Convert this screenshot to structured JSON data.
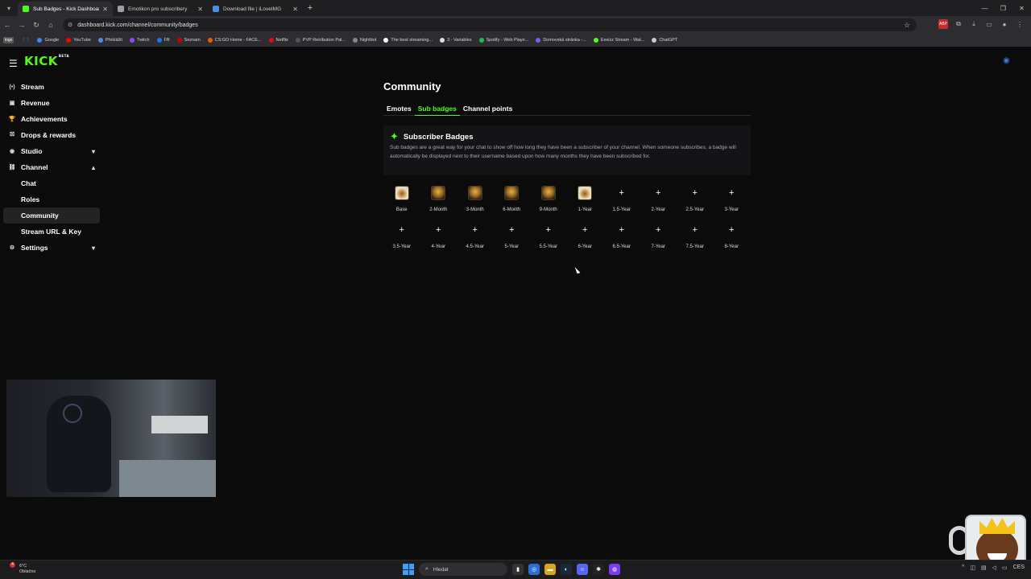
{
  "browser": {
    "tabs": [
      {
        "title": "Sub Badges - Kick Dashboard",
        "active": true,
        "color": "#53fc18"
      },
      {
        "title": "Emotikon pro subscribery",
        "active": false,
        "color": "#9aa0a6"
      },
      {
        "title": "Download file | iLoveIMG",
        "active": false,
        "color": "#4a90e2"
      }
    ],
    "url": "dashboard.kick.com/channel/community/badges",
    "bookmarks": [
      {
        "label": "logo",
        "color": "#555555"
      },
      {
        "label": "Google",
        "color": "#4285f4"
      },
      {
        "label": "YouTube",
        "color": "#ff0000"
      },
      {
        "label": "Překlážit",
        "color": "#4a90e2"
      },
      {
        "label": "Twitch",
        "color": "#9146ff"
      },
      {
        "label": "FB",
        "color": "#1877f2"
      },
      {
        "label": "Seznam",
        "color": "#cc0000"
      },
      {
        "label": "CS:GO Home - FACE...",
        "color": "#ff5500"
      },
      {
        "label": "Netflix",
        "color": "#e50914"
      },
      {
        "label": "PVP Retribution Pal...",
        "color": "#555555"
      },
      {
        "label": "Nightbot",
        "color": "#888888"
      },
      {
        "label": "The best streaming...",
        "color": "#ffffff"
      },
      {
        "label": "3 - Variables",
        "color": "#dddddd"
      },
      {
        "label": "Spotify - Web Playe...",
        "color": "#1db954"
      },
      {
        "label": "Domovská stránka -...",
        "color": "#7a5af8"
      },
      {
        "label": "Exeizz Stream - Wat...",
        "color": "#53fc18"
      },
      {
        "label": "ChatGPT",
        "color": "#cccccc"
      }
    ]
  },
  "app": {
    "logo": "KICK",
    "logo_tag": "BETA",
    "sidebar": [
      {
        "label": "Stream",
        "icon": "broadcast-icon",
        "glyph": "(•)",
        "sub": false,
        "chevron": ""
      },
      {
        "label": "Revenue",
        "icon": "wallet-icon",
        "glyph": "▣",
        "sub": false,
        "chevron": ""
      },
      {
        "label": "Achievements",
        "icon": "trophy-icon",
        "glyph": "🏆",
        "sub": false,
        "chevron": ""
      },
      {
        "label": "Drops & rewards",
        "icon": "gift-icon",
        "glyph": "⛝",
        "sub": false,
        "chevron": ""
      },
      {
        "label": "Studio",
        "icon": "camera-icon",
        "glyph": "◉",
        "sub": false,
        "chevron": "▾"
      },
      {
        "label": "Channel",
        "icon": "channel-icon",
        "glyph": "⛓",
        "sub": false,
        "chevron": "▴"
      },
      {
        "label": "Chat",
        "icon": "",
        "glyph": "",
        "sub": true,
        "chevron": ""
      },
      {
        "label": "Roles",
        "icon": "",
        "glyph": "",
        "sub": true,
        "chevron": ""
      },
      {
        "label": "Community",
        "icon": "",
        "glyph": "",
        "sub": true,
        "chevron": "",
        "active": true
      },
      {
        "label": "Stream URL & Key",
        "icon": "",
        "glyph": "",
        "sub": true,
        "chevron": ""
      },
      {
        "label": "Settings",
        "icon": "gear-icon",
        "glyph": "⚙",
        "sub": false,
        "chevron": "▾"
      }
    ]
  },
  "main": {
    "title": "Community",
    "tabs": [
      {
        "label": "Emotes",
        "active": false
      },
      {
        "label": "Sub badges",
        "active": true
      },
      {
        "label": "Channel points",
        "active": false
      }
    ],
    "card": {
      "title": "Subscriber Badges",
      "description": "Sub badges are a great way for your chat to show off how long they have been a subscriber of your channel. When someone subscribes, a badge will automatically be displayed next to their username based upon how many months they have been subscribed for."
    },
    "badges": [
      {
        "label": "Base",
        "image": "plate"
      },
      {
        "label": "2-Month",
        "image": "burger"
      },
      {
        "label": "3-Month",
        "image": "burger"
      },
      {
        "label": "6-Month",
        "image": "burger"
      },
      {
        "label": "9-Month",
        "image": "burger"
      },
      {
        "label": "1-Year",
        "image": "plate"
      },
      {
        "label": "1.5-Year",
        "image": ""
      },
      {
        "label": "2-Year",
        "image": ""
      },
      {
        "label": "2.5-Year",
        "image": ""
      },
      {
        "label": "3-Year",
        "image": ""
      },
      {
        "label": "3.5-Year",
        "image": ""
      },
      {
        "label": "4-Year",
        "image": ""
      },
      {
        "label": "4.5-Year",
        "image": ""
      },
      {
        "label": "5-Year",
        "image": ""
      },
      {
        "label": "5.5-Year",
        "image": ""
      },
      {
        "label": "6-Year",
        "image": ""
      },
      {
        "label": "6.5-Year",
        "image": ""
      },
      {
        "label": "7-Year",
        "image": ""
      },
      {
        "label": "7.5-Year",
        "image": ""
      },
      {
        "label": "8-Year",
        "image": ""
      }
    ],
    "add_glyph": "+"
  },
  "taskbar": {
    "weather_temp": "6°C",
    "weather_desc": "Oblačno",
    "notification_count": "4",
    "search_placeholder": "Hledat",
    "tray_text": "CES"
  },
  "colors": {
    "accent": "#53fc18",
    "background": "#0b0b0c"
  }
}
